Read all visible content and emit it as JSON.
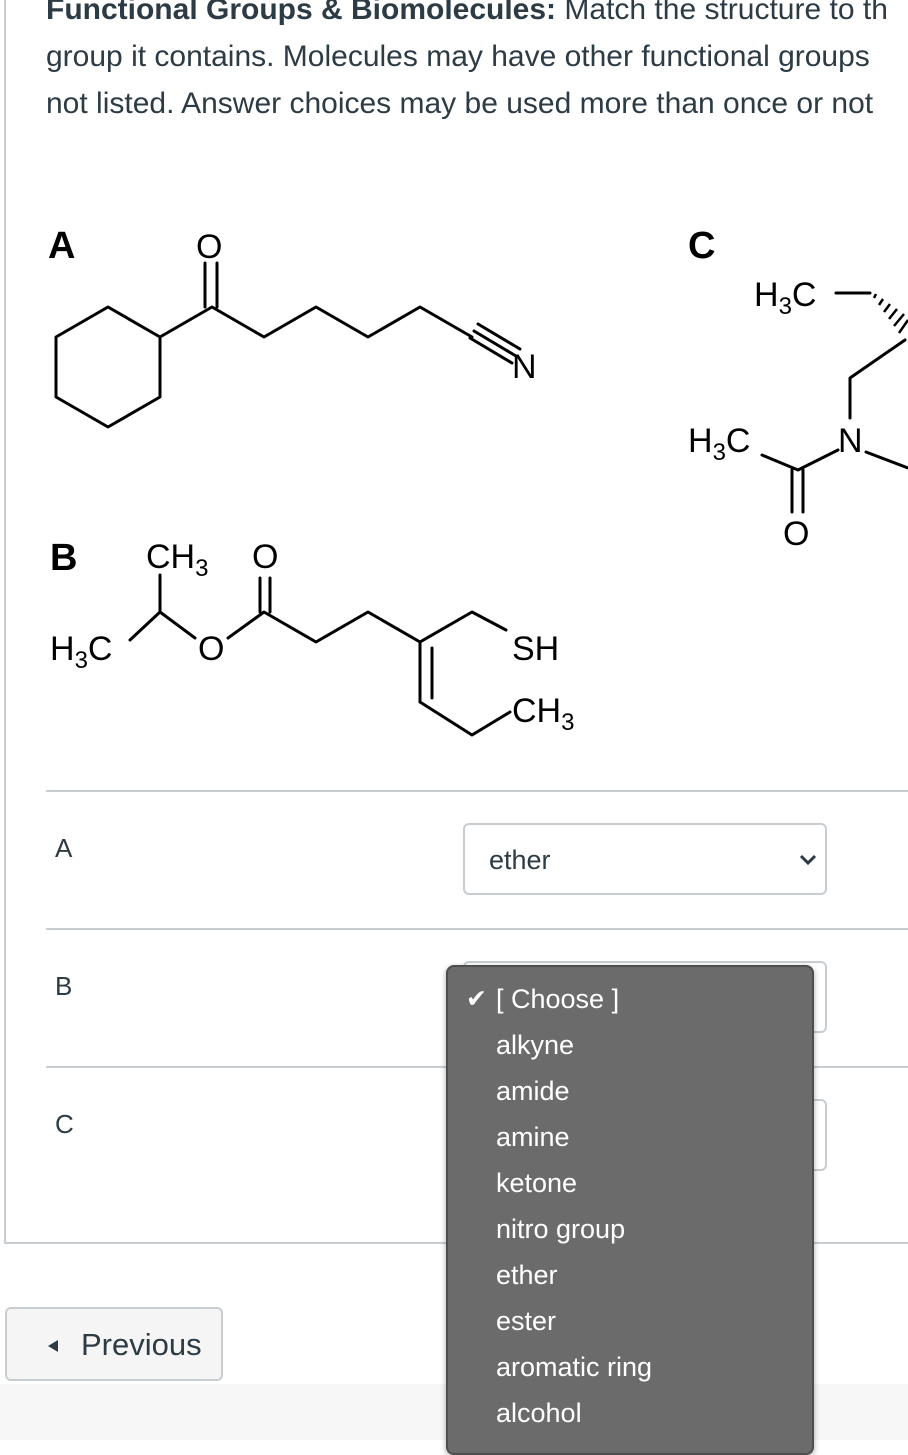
{
  "question": {
    "title": "Functional Groups & Biomolecules:",
    "text_line1": "Match the structure to th",
    "text_line2": "group it contains. Molecules may have other functional groups",
    "text_line3": "not listed. Answer choices may be used more than once or not"
  },
  "structures": {
    "label_a": "A",
    "label_b": "B",
    "label_c": "C",
    "a_oxygen": "O",
    "a_nitrogen": "N",
    "b_ch3": "CH",
    "b_ch3_sub": "3",
    "b_o_top": "O",
    "b_h3c": "H",
    "b_h3c_sub": "3",
    "b_h3c_c": "C",
    "b_o_ring": "O",
    "b_sh": "SH",
    "b_ch3_2": "CH",
    "b_ch3_2_sub": "3",
    "c_h3c_top": "H",
    "c_h3c_top_sub": "3",
    "c_h3c_top_c": "C",
    "c_h3c_left": "H",
    "c_h3c_left_sub": "3",
    "c_h3c_left_c": "C",
    "c_n": "N",
    "c_o": "O"
  },
  "rows": [
    {
      "label": "A",
      "selected": "ether"
    },
    {
      "label": "B",
      "selected": ""
    },
    {
      "label": "C",
      "selected": ""
    }
  ],
  "dropdown": {
    "options": [
      "[ Choose ]",
      "alkyne",
      "amide",
      "amine",
      "ketone",
      "nitro group",
      "ether",
      "ester",
      "aromatic ring",
      "alcohol"
    ],
    "checked_index": 0,
    "check_glyph": "✔"
  },
  "nav": {
    "previous_label": "Previous"
  },
  "colors": {
    "text": "#2d3b45",
    "border": "#c7cdd1",
    "dropdown_bg": "#6b6b6b"
  }
}
